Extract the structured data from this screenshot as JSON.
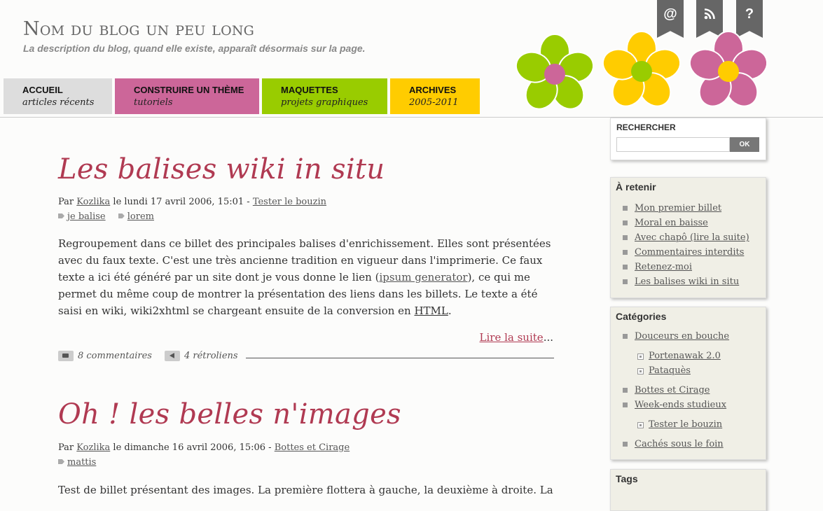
{
  "header": {
    "title": "Nom du blog un peu long",
    "description": "La description du blog, quand elle existe, apparaît désormais sur la page."
  },
  "nav": {
    "tabs": [
      {
        "label": "ACCUEIL",
        "sub": "articles récents"
      },
      {
        "label": "CONSTRUIRE UN THÈME",
        "sub": "tutoriels"
      },
      {
        "label": "MAQUETTES",
        "sub": "projets graphiques"
      },
      {
        "label": "ARCHIVES",
        "sub": "2005-2011"
      }
    ]
  },
  "bookmarks": [
    "@",
    "rss-icon",
    "?"
  ],
  "colors": {
    "accent": "#b03a52",
    "pink": "#cc6699",
    "green": "#99cc00",
    "yellow": "#ffcc00",
    "grey": "#dddddd"
  },
  "posts": [
    {
      "title": "Les balises wiki in situ",
      "meta_prefix": "Par",
      "author": "Kozlika",
      "date": "le lundi 17 avril 2006, 15:01 -",
      "category": "Tester le bouzin",
      "tags": [
        "je balise",
        "lorem"
      ],
      "body_1": "Regroupement dans ce billet des principales balises d'enrichissement. Elles sont présentées avec du faux texte. C'est une très ancienne tradition en vigueur dans l'imprimerie. Ce faux texte a ici été généré par un site dont je vous donne le lien (",
      "body_link": "ipsum generator",
      "body_2": "), ce qui me permet du même coup de montrer la présentation des liens dans les billets. Le texte a été saisi en wiki, wiki2xhtml se chargeant ensuite de la conversion en ",
      "body_abbr": "HTML",
      "body_3": ".",
      "read_more": "Lire la suite",
      "read_more_suffix": "...",
      "comments": "8 commentaires",
      "trackbacks": "4 rétroliens"
    },
    {
      "title": "Oh ! les belles n'images",
      "meta_prefix": "Par",
      "author": "Kozlika",
      "date": "le dimanche 16 avril 2006, 15:06 -",
      "category": "Bottes et Cirage",
      "tags": [
        "mattis"
      ],
      "body_1": "Test de billet présentant des images. La première flottera à gauche, la deuxième à droite. La"
    }
  ],
  "sidebar": {
    "search": {
      "title": "RECHERCHER",
      "button": "OK",
      "value": ""
    },
    "retenir": {
      "title": "À retenir",
      "items": [
        "Mon premier billet",
        "Moral en baisse",
        "Avec chapô (lire la suite)",
        "Commentaires interdits",
        "Retenez-moi",
        "Les balises wiki in situ"
      ]
    },
    "categories": {
      "title": "Catégories",
      "items": [
        "Douceurs en bouche",
        "Portenawak 2.0",
        "Pataquès",
        "Bottes et Cirage",
        "Week-ends studieux",
        "Tester le bouzin",
        "Cachés sous le foin"
      ]
    },
    "tags": {
      "title": "Tags"
    }
  }
}
